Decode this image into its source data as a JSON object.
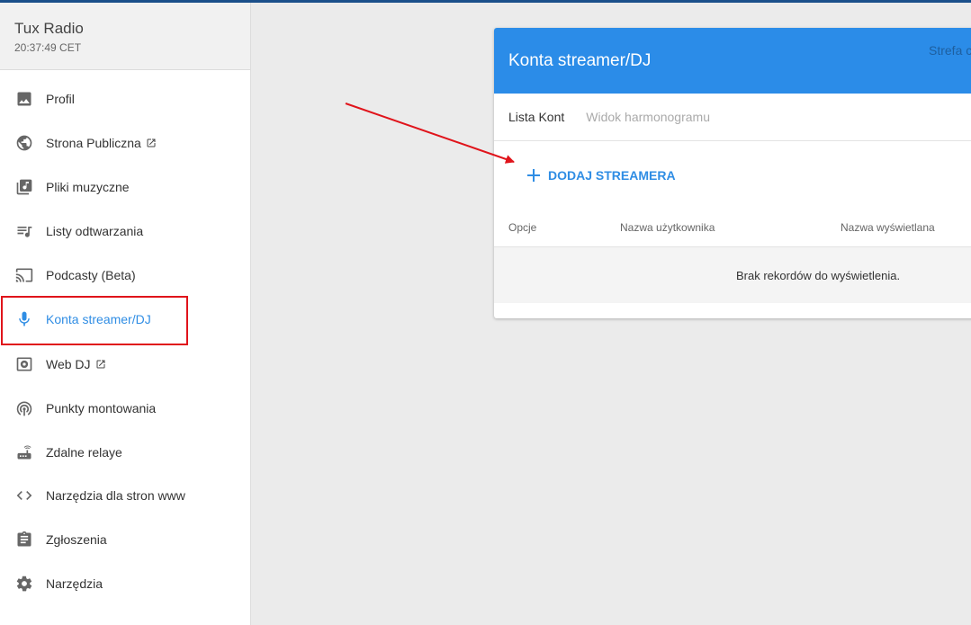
{
  "sidebar": {
    "title": "Tux Radio",
    "time": "20:37:49 CET",
    "items": [
      {
        "label": "Profil",
        "icon": "image-icon"
      },
      {
        "label": "Strona Publiczna",
        "icon": "globe-icon",
        "external": true
      },
      {
        "label": "Pliki muzyczne",
        "icon": "music-library-icon"
      },
      {
        "label": "Listy odtwarzania",
        "icon": "playlist-icon"
      },
      {
        "label": "Podcasty (Beta)",
        "icon": "cast-icon"
      },
      {
        "label": "Konta streamer/DJ",
        "icon": "microphone-icon",
        "active": true
      },
      {
        "label": "Web DJ",
        "icon": "speaker-icon",
        "external": true
      },
      {
        "label": "Punkty montowania",
        "icon": "broadcast-icon"
      },
      {
        "label": "Zdalne relaye",
        "icon": "router-icon"
      },
      {
        "label": "Narzędzia dla stron www",
        "icon": "code-icon"
      },
      {
        "label": "Zgłoszenia",
        "icon": "clipboard-icon"
      },
      {
        "label": "Narzędzia",
        "icon": "gear-icon"
      }
    ]
  },
  "card": {
    "title": "Konta streamer/DJ",
    "timezone": "Strefa c",
    "tabs": [
      {
        "label": "Lista Kont",
        "active": true
      },
      {
        "label": "Widok harmonogramu",
        "active": false
      }
    ],
    "add_label": "DODAJ STREAMERA",
    "columns": [
      "Opcje",
      "Nazwa użytkownika",
      "Nazwa wyświetlana"
    ],
    "empty_text": "Brak rekordów do wyświetlenia."
  },
  "colors": {
    "accent": "#2b8ce8",
    "annotation": "#e0141b"
  }
}
